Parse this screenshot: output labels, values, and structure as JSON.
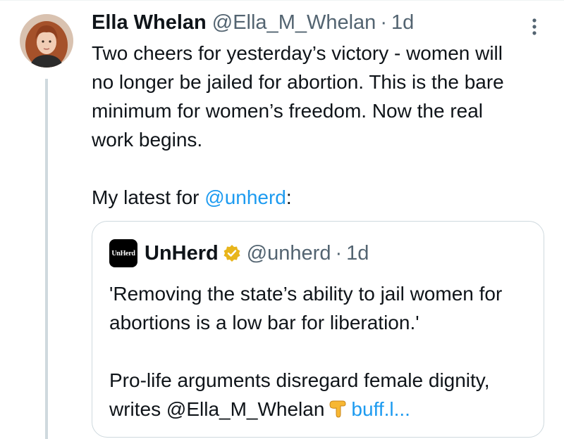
{
  "tweet": {
    "author_name": "Ella Whelan",
    "author_handle": "@Ella_M_Whelan",
    "separator": "·",
    "time": "1d",
    "text_line1": "Two cheers for yesterday’s victory - women will no longer be jailed for abortion. This is the bare minimum for women’s freedom. Now the real work begins.",
    "latest_prefix": "My latest for ",
    "latest_mention": "@unherd",
    "latest_suffix": ":"
  },
  "quote": {
    "logo_text": "UnHerd",
    "name": "UnHerd",
    "verified": "gold-verified-badge",
    "handle": "@unherd",
    "separator": "·",
    "time": "1d",
    "text_line1": "'Removing the state’s ability to jail women for abortions is a low bar for liberation.'",
    "text_line2_prefix": "Pro-life arguments disregard female dignity, writes @Ella_M_Whelan",
    "text_line2_suffix": "buff.l...",
    "emoji": "backhand-index-pointing-down"
  },
  "colors": {
    "text": "#0f1419",
    "secondary": "#536471",
    "link": "#1d9bf0",
    "border": "#cfd9de",
    "verified_gold": "#e8b51b"
  }
}
